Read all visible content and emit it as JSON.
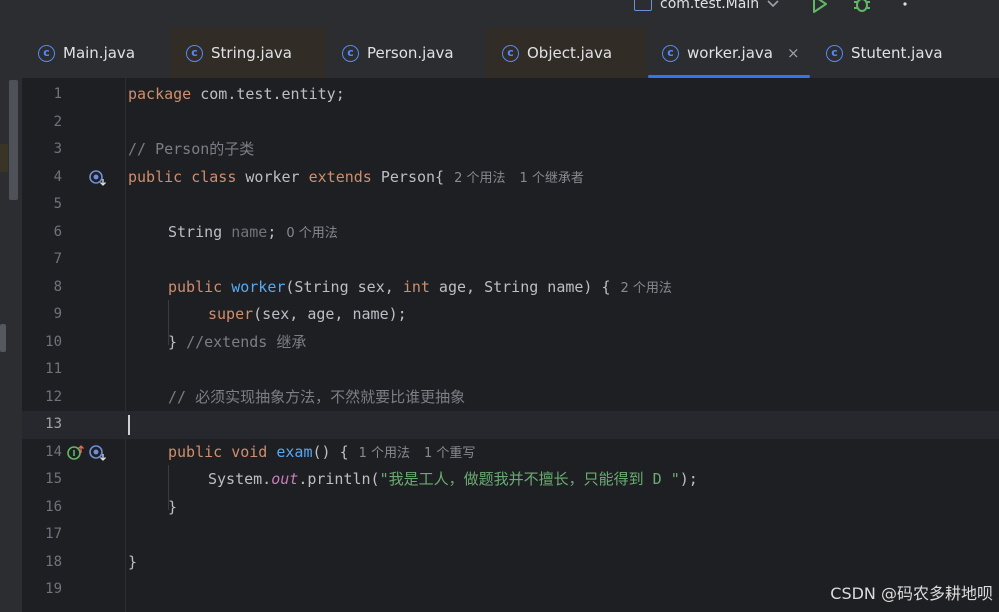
{
  "toolbar": {
    "run_config": "com.test.Main",
    "icons": [
      "config-icon",
      "chevron-down-icon",
      "run-icon",
      "debug-icon",
      "more-vertical-icon"
    ]
  },
  "tabs": [
    {
      "label": "Main.java",
      "icon": "class-icon"
    },
    {
      "label": "String.java",
      "icon": "class-icon"
    },
    {
      "label": "Person.java",
      "icon": "class-icon"
    },
    {
      "label": "Object.java",
      "icon": "class-icon"
    },
    {
      "label": "worker.java",
      "icon": "class-icon",
      "active": true,
      "close": "×"
    },
    {
      "label": "Stutent.java",
      "icon": "class-icon"
    }
  ],
  "editor": {
    "line_numbers": [
      "1",
      "2",
      "3",
      "4",
      "5",
      "6",
      "7",
      "8",
      "9",
      "10",
      "11",
      "12",
      "13",
      "14",
      "15",
      "16",
      "17",
      "18",
      "19"
    ],
    "current_line": "13",
    "code": {
      "l1_kw": "package",
      "l1_rest": " com.test.entity;",
      "l3_comment": "// Person的子类",
      "l4_public": "public",
      "l4_class": "class",
      "l4_name": "worker",
      "l4_extends": "extends",
      "l4_parent": "Person{",
      "l6_type": "String",
      "l6_field": "name",
      "l6_semi": ";",
      "l8_public": "public",
      "l8_ctor": "worker",
      "l8_p1": "(String sex, ",
      "l8_int": "int",
      "l8_p2": " age, String name) {",
      "l9_super": "super",
      "l9_args": "(sex, age, name);",
      "l10_brace": "}",
      "l10_comment": "//extends 继承",
      "l12_comment": "// 必须实现抽象方法，不然就要比谁更抽象",
      "l14_public": "public",
      "l14_void": "void",
      "l14_method": "exam",
      "l14_rest": "() {",
      "l15_sys": "System.",
      "l15_out": "out",
      "l15_println": ".println(",
      "l15_str": "\"我是工人，做题我并不擅长，只能得到 D \"",
      "l15_end": ");",
      "l16_brace": "}",
      "l18_brace": "}"
    },
    "hints": {
      "l4_usages": "2 个用法",
      "l4_inheritors": "1 个继承者",
      "l6_usages": "0 个用法",
      "l8_usages": "2 个用法",
      "l14_usages": "1 个用法",
      "l14_overrides": "1 个重写"
    }
  },
  "watermark": "CSDN @码农多耕地呗"
}
